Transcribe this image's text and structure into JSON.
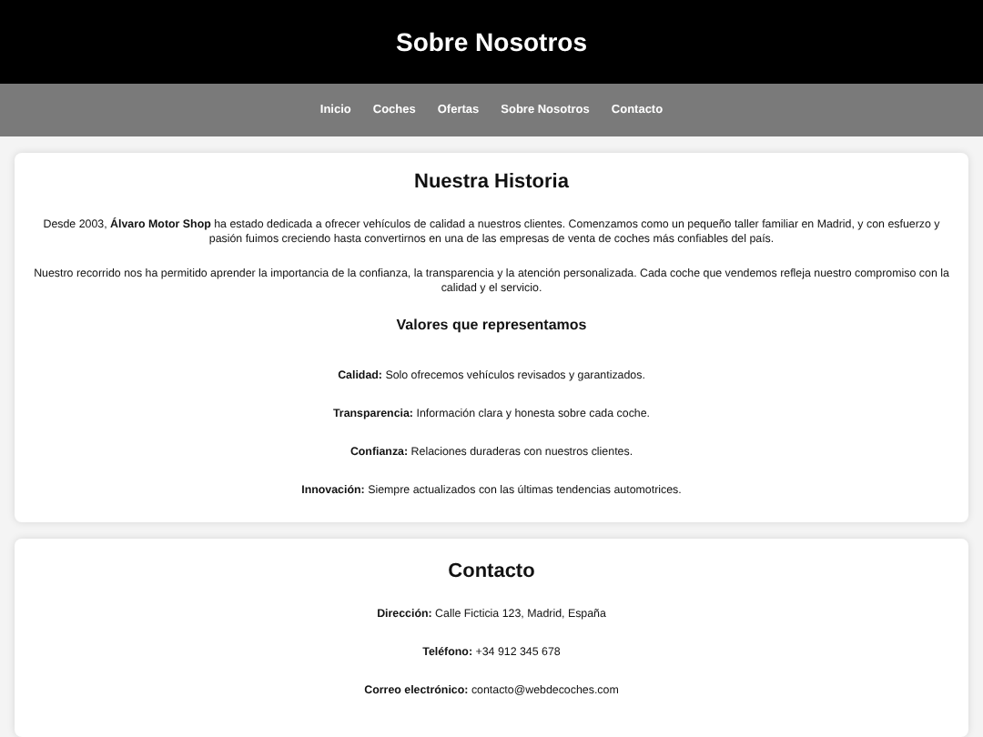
{
  "header": {
    "title": "Sobre Nosotros"
  },
  "nav": [
    "Inicio",
    "Coches",
    "Ofertas",
    "Sobre Nosotros",
    "Contacto"
  ],
  "history": {
    "title": "Nuestra Historia",
    "paragraphs": [
      "Desde 2003, **Álvaro Motor Shop** ha estado dedicada a ofrecer vehículos de calidad a nuestros clientes. Comenzamos como un pequeño taller familiar en Madrid, y con esfuerzo y pasión fuimos creciendo hasta convertirnos en una de las empresas de venta de coches más confiables del país.",
      "Nuestro recorrido nos ha permitido aprender la importancia de la confianza, la transparencia y la atención personalizada. Cada coche que vendemos refleja nuestro compromiso con la calidad y el servicio."
    ],
    "values_title": "Valores que representamos",
    "values": [
      "**Calidad:** Solo ofrecemos vehículos revisados y garantizados.",
      "**Transparencia:** Información clara y honesta sobre cada coche.",
      "**Confianza:** Relaciones duraderas con nuestros clientes.",
      "**Innovación:** Siempre actualizados con las últimas tendencias automotrices."
    ]
  },
  "contact": {
    "title": "Contacto",
    "lines": [
      "**Dirección:** Calle Ficticia 123, Madrid, España",
      "**Teléfono:** +34 912 345 678",
      "**Correo electrónico:** contacto@webdecoches.com"
    ]
  }
}
